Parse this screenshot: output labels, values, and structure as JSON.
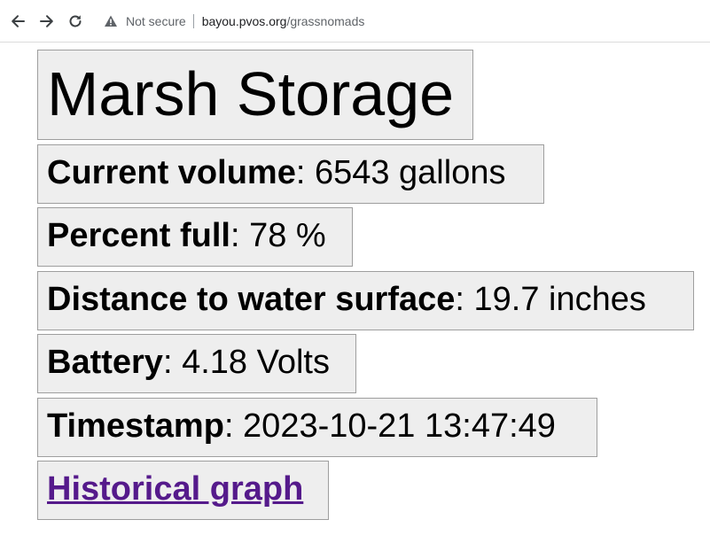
{
  "browser": {
    "security_label": "Not secure",
    "url_host": "bayou.pvos.org",
    "url_path": "/grassnomads"
  },
  "page": {
    "title": "Marsh Storage",
    "rows": [
      {
        "label": "Current volume",
        "value": ": 6543 gallons"
      },
      {
        "label": "Percent full",
        "value": ": 78 %"
      },
      {
        "label": "Distance to water surface",
        "value": ": 19.7 inches"
      },
      {
        "label": "Battery",
        "value": ": 4.18 Volts"
      },
      {
        "label": "Timestamp",
        "value": ": 2023-10-21 13:47:49"
      }
    ],
    "link_label": "Historical graph"
  },
  "colors": {
    "box_bg": "#eeeeee",
    "link": "#551a8b"
  }
}
